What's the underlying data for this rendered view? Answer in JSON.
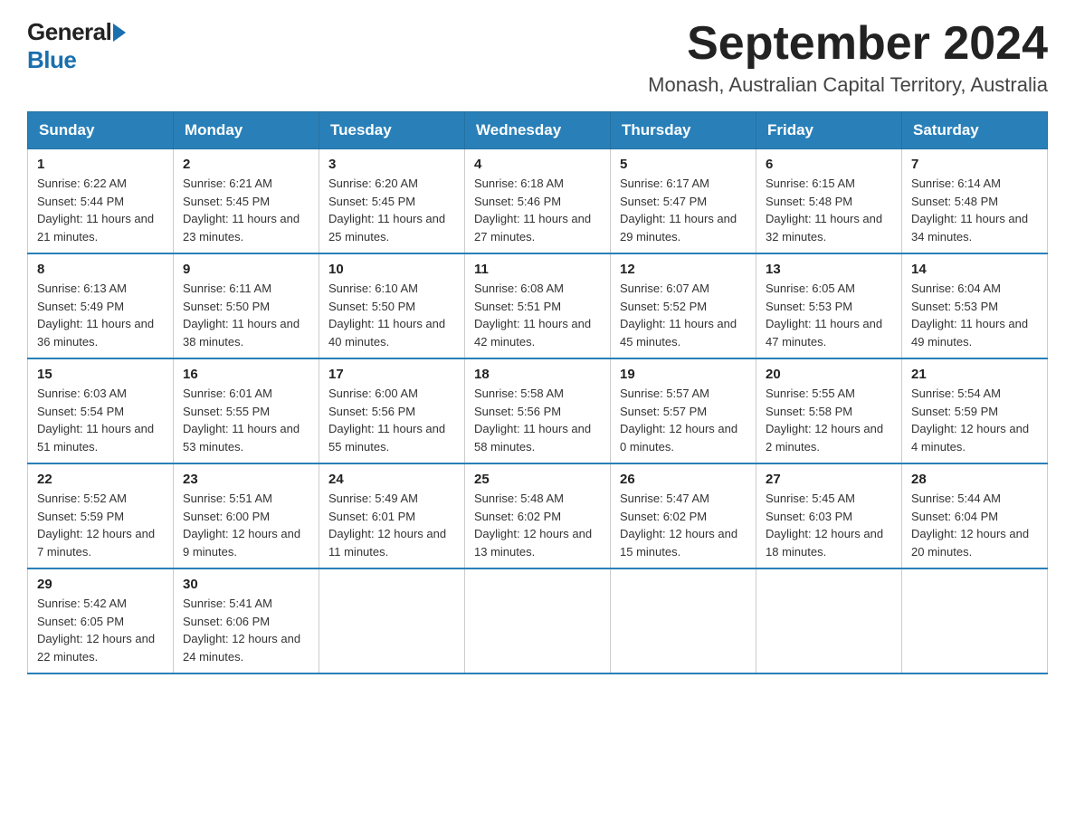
{
  "logo": {
    "general": "General",
    "blue": "Blue"
  },
  "title": "September 2024",
  "subtitle": "Monash, Australian Capital Territory, Australia",
  "days_of_week": [
    "Sunday",
    "Monday",
    "Tuesday",
    "Wednesday",
    "Thursday",
    "Friday",
    "Saturday"
  ],
  "weeks": [
    [
      {
        "day": "1",
        "sunrise": "6:22 AM",
        "sunset": "5:44 PM",
        "daylight": "11 hours and 21 minutes."
      },
      {
        "day": "2",
        "sunrise": "6:21 AM",
        "sunset": "5:45 PM",
        "daylight": "11 hours and 23 minutes."
      },
      {
        "day": "3",
        "sunrise": "6:20 AM",
        "sunset": "5:45 PM",
        "daylight": "11 hours and 25 minutes."
      },
      {
        "day": "4",
        "sunrise": "6:18 AM",
        "sunset": "5:46 PM",
        "daylight": "11 hours and 27 minutes."
      },
      {
        "day": "5",
        "sunrise": "6:17 AM",
        "sunset": "5:47 PM",
        "daylight": "11 hours and 29 minutes."
      },
      {
        "day": "6",
        "sunrise": "6:15 AM",
        "sunset": "5:48 PM",
        "daylight": "11 hours and 32 minutes."
      },
      {
        "day": "7",
        "sunrise": "6:14 AM",
        "sunset": "5:48 PM",
        "daylight": "11 hours and 34 minutes."
      }
    ],
    [
      {
        "day": "8",
        "sunrise": "6:13 AM",
        "sunset": "5:49 PM",
        "daylight": "11 hours and 36 minutes."
      },
      {
        "day": "9",
        "sunrise": "6:11 AM",
        "sunset": "5:50 PM",
        "daylight": "11 hours and 38 minutes."
      },
      {
        "day": "10",
        "sunrise": "6:10 AM",
        "sunset": "5:50 PM",
        "daylight": "11 hours and 40 minutes."
      },
      {
        "day": "11",
        "sunrise": "6:08 AM",
        "sunset": "5:51 PM",
        "daylight": "11 hours and 42 minutes."
      },
      {
        "day": "12",
        "sunrise": "6:07 AM",
        "sunset": "5:52 PM",
        "daylight": "11 hours and 45 minutes."
      },
      {
        "day": "13",
        "sunrise": "6:05 AM",
        "sunset": "5:53 PM",
        "daylight": "11 hours and 47 minutes."
      },
      {
        "day": "14",
        "sunrise": "6:04 AM",
        "sunset": "5:53 PM",
        "daylight": "11 hours and 49 minutes."
      }
    ],
    [
      {
        "day": "15",
        "sunrise": "6:03 AM",
        "sunset": "5:54 PM",
        "daylight": "11 hours and 51 minutes."
      },
      {
        "day": "16",
        "sunrise": "6:01 AM",
        "sunset": "5:55 PM",
        "daylight": "11 hours and 53 minutes."
      },
      {
        "day": "17",
        "sunrise": "6:00 AM",
        "sunset": "5:56 PM",
        "daylight": "11 hours and 55 minutes."
      },
      {
        "day": "18",
        "sunrise": "5:58 AM",
        "sunset": "5:56 PM",
        "daylight": "11 hours and 58 minutes."
      },
      {
        "day": "19",
        "sunrise": "5:57 AM",
        "sunset": "5:57 PM",
        "daylight": "12 hours and 0 minutes."
      },
      {
        "day": "20",
        "sunrise": "5:55 AM",
        "sunset": "5:58 PM",
        "daylight": "12 hours and 2 minutes."
      },
      {
        "day": "21",
        "sunrise": "5:54 AM",
        "sunset": "5:59 PM",
        "daylight": "12 hours and 4 minutes."
      }
    ],
    [
      {
        "day": "22",
        "sunrise": "5:52 AM",
        "sunset": "5:59 PM",
        "daylight": "12 hours and 7 minutes."
      },
      {
        "day": "23",
        "sunrise": "5:51 AM",
        "sunset": "6:00 PM",
        "daylight": "12 hours and 9 minutes."
      },
      {
        "day": "24",
        "sunrise": "5:49 AM",
        "sunset": "6:01 PM",
        "daylight": "12 hours and 11 minutes."
      },
      {
        "day": "25",
        "sunrise": "5:48 AM",
        "sunset": "6:02 PM",
        "daylight": "12 hours and 13 minutes."
      },
      {
        "day": "26",
        "sunrise": "5:47 AM",
        "sunset": "6:02 PM",
        "daylight": "12 hours and 15 minutes."
      },
      {
        "day": "27",
        "sunrise": "5:45 AM",
        "sunset": "6:03 PM",
        "daylight": "12 hours and 18 minutes."
      },
      {
        "day": "28",
        "sunrise": "5:44 AM",
        "sunset": "6:04 PM",
        "daylight": "12 hours and 20 minutes."
      }
    ],
    [
      {
        "day": "29",
        "sunrise": "5:42 AM",
        "sunset": "6:05 PM",
        "daylight": "12 hours and 22 minutes."
      },
      {
        "day": "30",
        "sunrise": "5:41 AM",
        "sunset": "6:06 PM",
        "daylight": "12 hours and 24 minutes."
      },
      null,
      null,
      null,
      null,
      null
    ]
  ]
}
